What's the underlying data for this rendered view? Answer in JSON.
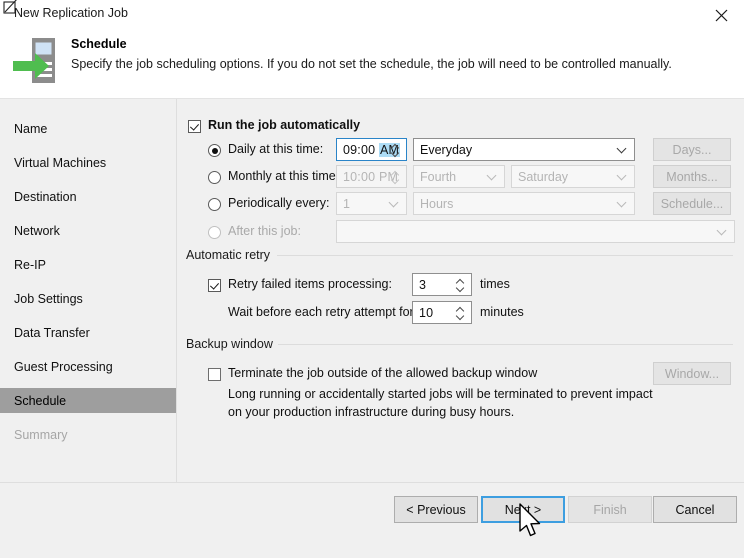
{
  "window": {
    "title": "New Replication Job",
    "close_icon": "close-icon"
  },
  "header": {
    "title": "Schedule",
    "description": "Specify the job scheduling options. If you do not set the schedule, the job will need to be controlled manually.",
    "icon": "replication-schedule-icon"
  },
  "sidebar": {
    "items": [
      {
        "label": "Name",
        "state": "normal"
      },
      {
        "label": "Virtual Machines",
        "state": "normal"
      },
      {
        "label": "Destination",
        "state": "normal"
      },
      {
        "label": "Network",
        "state": "normal"
      },
      {
        "label": "Re-IP",
        "state": "normal"
      },
      {
        "label": "Job Settings",
        "state": "normal"
      },
      {
        "label": "Data Transfer",
        "state": "normal"
      },
      {
        "label": "Guest Processing",
        "state": "normal"
      },
      {
        "label": "Schedule",
        "state": "active"
      },
      {
        "label": "Summary",
        "state": "disabled"
      }
    ]
  },
  "main": {
    "run_automatically": {
      "label": "Run the job automatically",
      "checked": true
    },
    "daily": {
      "label": "Daily at this time:",
      "selected": true,
      "time_value": "09:00 ",
      "time_meridiem": "AM",
      "frequency": "Everyday",
      "button": "Days..."
    },
    "monthly": {
      "label": "Monthly at this time:",
      "selected": false,
      "time_value": "10:00 PM",
      "ordinal": "Fourth",
      "weekday": "Saturday",
      "button": "Months..."
    },
    "periodically": {
      "label": "Periodically every:",
      "selected": false,
      "count": "1",
      "unit": "Hours",
      "button": "Schedule..."
    },
    "after_job": {
      "label": "After this job:",
      "selected": false,
      "value": ""
    },
    "automatic_retry": {
      "group_label": "Automatic retry",
      "retry_checkbox_label": "Retry failed items processing:",
      "retry_checked": true,
      "retry_times": "3",
      "retry_times_unit": "times",
      "wait_label": "Wait before each retry attempt for:",
      "wait_value": "10",
      "wait_unit": "minutes"
    },
    "backup_window": {
      "group_label": "Backup window",
      "terminate_label": "Terminate the job outside of the allowed backup window",
      "terminate_checked": false,
      "hint_line1": "Long running or accidentally started jobs will be terminated to prevent impact",
      "hint_line2": "on your production infrastructure during busy hours.",
      "button": "Window..."
    }
  },
  "footer": {
    "previous": "< Previous",
    "next": "Next >",
    "finish": "Finish",
    "cancel": "Cancel"
  },
  "colors": {
    "accent": "#3d9ee0",
    "selection": "#addcf5",
    "sidebar_active": "#9e9e9e",
    "panel": "#f0f0f0",
    "icon_green": "#4fbd4f"
  }
}
